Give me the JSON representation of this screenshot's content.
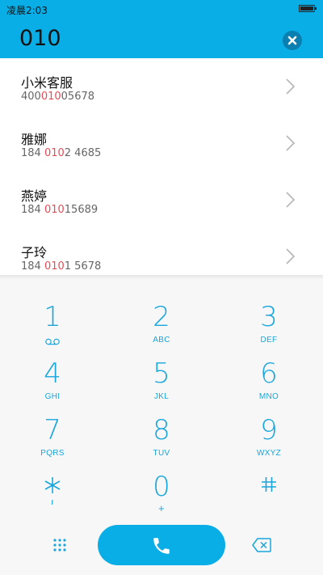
{
  "status_bar": {
    "time": "凌晨2:03"
  },
  "dialer": {
    "input_value": "010"
  },
  "results": [
    {
      "name": "小米客服",
      "number_parts": [
        "400",
        "010",
        "05678"
      ]
    },
    {
      "name": "雅娜",
      "number_parts": [
        "184 ",
        "010",
        "2 4685"
      ]
    },
    {
      "name": "燕婷",
      "number_parts": [
        "184 ",
        "010",
        "15689"
      ]
    },
    {
      "name": "子玲",
      "number_parts": [
        "184 ",
        "010",
        "1 5678"
      ]
    }
  ],
  "keypad": [
    {
      "digit": "1",
      "letters": ""
    },
    {
      "digit": "2",
      "letters": "ABC"
    },
    {
      "digit": "3",
      "letters": "DEF"
    },
    {
      "digit": "4",
      "letters": "GHI"
    },
    {
      "digit": "5",
      "letters": "JKL"
    },
    {
      "digit": "6",
      "letters": "MNO"
    },
    {
      "digit": "7",
      "letters": "PQRS"
    },
    {
      "digit": "8",
      "letters": "TUV"
    },
    {
      "digit": "9",
      "letters": "WXYZ"
    },
    {
      "digit": "",
      "letters": ""
    },
    {
      "digit": "0",
      "letters": "+"
    },
    {
      "digit": "",
      "letters": ""
    }
  ],
  "colors": {
    "accent": "#0aaee6",
    "digit": "#19a6dc",
    "match_highlight": "#ea4a55"
  },
  "icons": {
    "voicemail": "voicemail-icon",
    "star": "asterisk-icon",
    "hash": "hash-icon",
    "clear": "clear-icon",
    "chevron": "chevron-right-icon",
    "call": "phone-icon",
    "grid": "dialpad-grid-icon",
    "backspace": "backspace-icon",
    "battery": "battery-icon"
  }
}
